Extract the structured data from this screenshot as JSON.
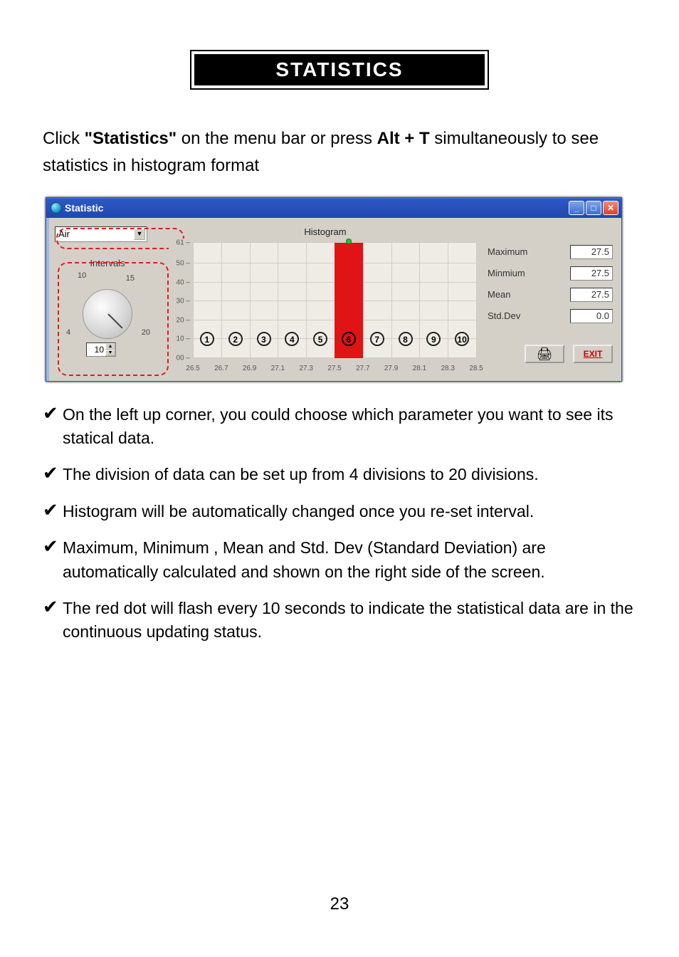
{
  "title": "STATISTICS",
  "intro_parts": {
    "p1": "Click ",
    "p2": "\"Statistics\"",
    "p3": " on the menu bar or press ",
    "p4": "Alt + T",
    "p5": " simultaneously  to see statistics in histogram format"
  },
  "window": {
    "title": "Statistic",
    "dropdown_value": "Air",
    "intervals_label": "Intervals",
    "knob_ticks": {
      "t4": "4",
      "t10": "10",
      "t15": "15",
      "t20": "20"
    },
    "interval_value": "10",
    "chart_title": "Histogram",
    "stats": {
      "maximum_label": "Maximum",
      "maximum_value": "27.5",
      "minimum_label": "Minmium",
      "minimum_value": "27.5",
      "mean_label": "Mean",
      "mean_value": "27.5",
      "stddev_label": "Std.Dev",
      "stddev_value": "0.0"
    },
    "exit_label": "EXIT"
  },
  "chart_data": {
    "type": "bar",
    "title": "Histogram",
    "xlabel": "",
    "ylabel": "",
    "ylim": [
      0,
      61
    ],
    "y_ticks": [
      0,
      10,
      20,
      30,
      40,
      50,
      61
    ],
    "categories": [
      "26.5",
      "26.7",
      "26.9",
      "27.1",
      "27.3",
      "27.5",
      "27.7",
      "27.9",
      "28.1",
      "28.3",
      "28.5"
    ],
    "bin_labels": [
      "1",
      "2",
      "3",
      "4",
      "5",
      "6",
      "7",
      "8",
      "9",
      "10"
    ],
    "values": [
      0,
      0,
      0,
      0,
      0,
      61,
      0,
      0,
      0,
      0
    ]
  },
  "bullets": [
    "On the left up corner, you could choose which parameter you want to see its statical data.",
    "The division of data can be set up from 4 divisions to 20 divisions.",
    "Histogram will be automatically changed once you re-set interval.",
    "Maximum, Minimum , Mean and Std. Dev (Standard Deviation) are automatically calculated and shown on the right side of the screen.",
    "The red dot will flash every 10 seconds to indicate the statistical data are in the continuous updating status."
  ],
  "page_number": "23"
}
